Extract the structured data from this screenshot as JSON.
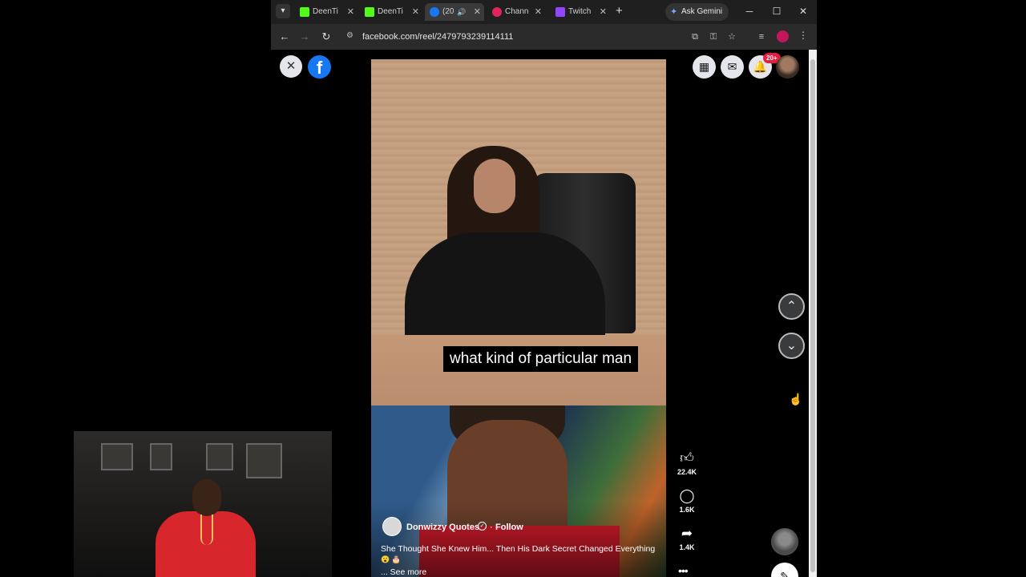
{
  "browser": {
    "tabs": [
      {
        "title": "DeenTi",
        "favicon": "kick-icon",
        "active": false
      },
      {
        "title": "DeenTi",
        "favicon": "kick-icon",
        "active": false
      },
      {
        "title": "(20",
        "favicon": "facebook-icon",
        "active": true,
        "audio": true
      },
      {
        "title": "Chann",
        "favicon": "channel-icon",
        "active": false
      },
      {
        "title": "Twitch",
        "favicon": "twitch-icon",
        "active": false
      }
    ],
    "new_tab": "+",
    "gemini_label": "Ask Gemini",
    "url": "facebook.com/reel/2479793239114111"
  },
  "facebook": {
    "notification_badge": "20+",
    "reels": [
      {
        "caption": "what kind of particular man"
      },
      {
        "author": "Donwizzy Quotes",
        "follow_label": "Follow",
        "title": "She Thought She Knew Him... Then His Dark Secret Changed Everything",
        "see_more": "... See more",
        "likes": "22.4K",
        "comments": "1.6K",
        "shares": "1.4K"
      }
    ]
  },
  "colors": {
    "facebook_blue": "#1877f2",
    "notification_red": "#e41e3f",
    "tab_bar": "#1f1f1f"
  }
}
